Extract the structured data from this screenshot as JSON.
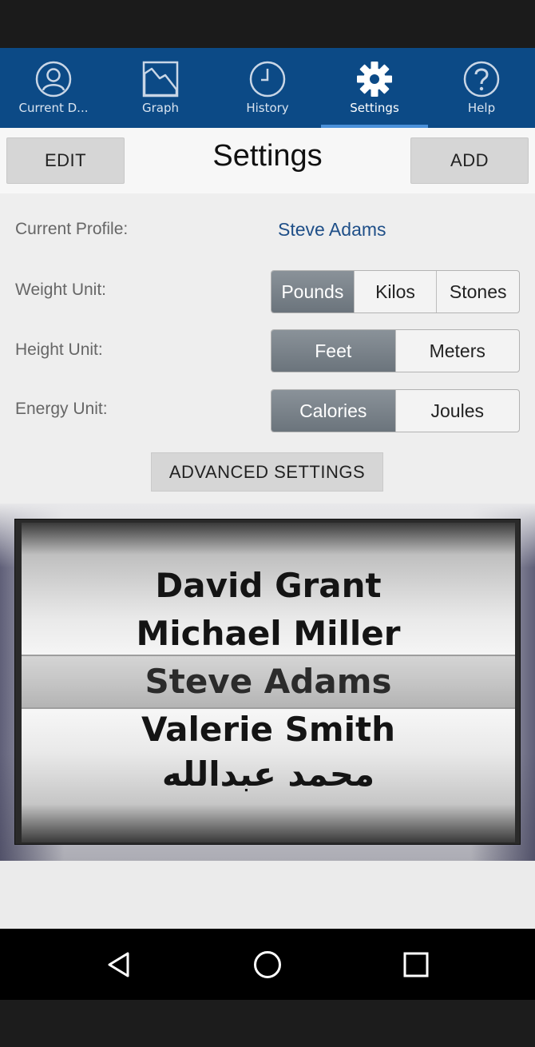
{
  "tabs": [
    {
      "label": "Current D...",
      "icon": "profile-icon",
      "active": false
    },
    {
      "label": "Graph",
      "icon": "graph-icon",
      "active": false
    },
    {
      "label": "History",
      "icon": "clock-icon",
      "active": false
    },
    {
      "label": "Settings",
      "icon": "gear-icon",
      "active": true
    },
    {
      "label": "Help",
      "icon": "help-icon",
      "active": false
    }
  ],
  "header": {
    "title": "Settings",
    "edit_label": "EDIT",
    "add_label": "ADD"
  },
  "settings": {
    "profile_label": "Current Profile:",
    "profile_value": "Steve Adams",
    "weight_label": "Weight Unit:",
    "weight_options": [
      "Pounds",
      "Kilos",
      "Stones"
    ],
    "weight_selected": "Pounds",
    "height_label": "Height Unit:",
    "height_options": [
      "Feet",
      "Meters"
    ],
    "height_selected": "Feet",
    "energy_label": "Energy Unit:",
    "energy_options": [
      "Calories",
      "Joules"
    ],
    "energy_selected": "Calories",
    "advanced_label": "ADVANCED SETTINGS"
  },
  "picker": {
    "items": [
      "David Grant",
      "Michael Miller",
      "Steve Adams",
      "Valerie Smith",
      "محمد عبدالله"
    ],
    "selected": "Steve Adams"
  },
  "colors": {
    "tab_bar": "#0c4a86",
    "active_tab_indicator": "#4a90d9",
    "profile_value": "#1f4f88",
    "segment_selected": "#7a838b"
  },
  "nav": {
    "back": "back-icon",
    "home": "home-icon",
    "recents": "recents-icon"
  }
}
